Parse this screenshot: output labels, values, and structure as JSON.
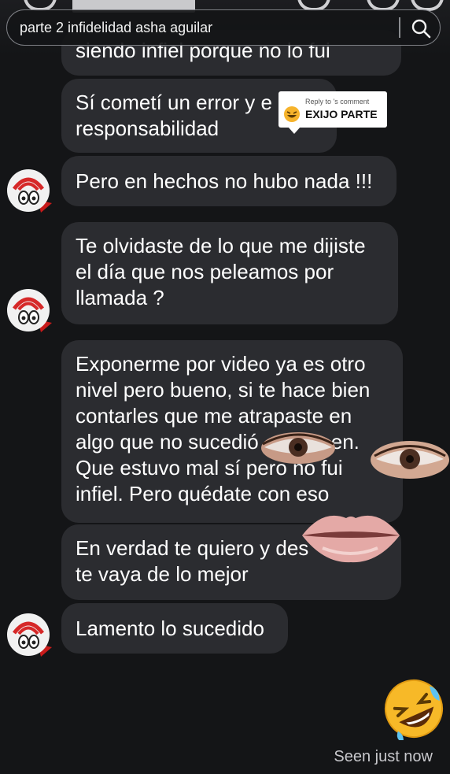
{
  "search": {
    "text": "parte 2 infidelidad asha aguilar"
  },
  "reply_card": {
    "small_text": "Reply to 's comment",
    "big_text": "EXIJO PARTE"
  },
  "messages": [
    {
      "lines": [
        "siendo infiel porque no lo fui"
      ]
    },
    {
      "lines": [
        "Sí cometí un error y e",
        "responsabilidad"
      ]
    },
    {
      "lines": [
        "Pero en hechos no hubo nada !!!"
      ]
    },
    {
      "lines": [
        "Te olvidaste de lo que me dijiste",
        "el día que nos peleamos por",
        "llamada ?"
      ]
    },
    {
      "lines": [
        "Exponerme por video ya es otro",
        "nivel pero bueno, si te hace bien",
        "contarles que me atrapaste en",
        "algo que no sucedió",
        "Que estuvo mal sí pero no fui",
        "infiel. Pero quédate con eso"
      ]
    },
    {
      "lines": [
        "En verdad te quiero y des",
        "te vaya de lo mejor"
      ]
    },
    {
      "lines": [
        "Lamento lo sucedido"
      ]
    }
  ],
  "partial_word": "en.",
  "seen_text": "Seen just now",
  "colors": {
    "background": "#141517",
    "bubble": "#2b2c30"
  }
}
